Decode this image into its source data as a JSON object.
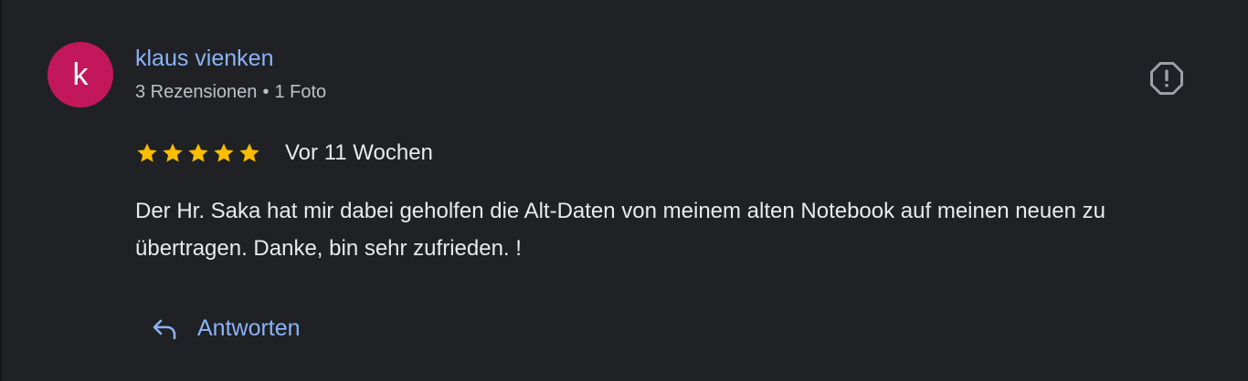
{
  "review": {
    "avatar_letter": "k",
    "avatar_color": "#c2185b",
    "author_name": "klaus vienken",
    "reviews_count": "3 Rezensionen",
    "separator": "•",
    "photos_count": "1 Foto",
    "rating": 5,
    "rating_max": 5,
    "star_color": "#fbbc04",
    "date": "Vor 11 Wochen",
    "text": "Der Hr. Saka hat mir dabei geholfen die Alt-Daten von meinem alten Notebook auf meinen neuen zu übertragen. Danke, bin sehr zufrieden. !",
    "report_icon": "report-octagon-icon"
  },
  "actions": {
    "reply_label": "Antworten",
    "reply_icon": "reply-arrow-icon"
  },
  "colors": {
    "background": "#202124",
    "link": "#8ab4f8",
    "text": "#e8eaed",
    "secondary_text": "#bdc1c6"
  }
}
